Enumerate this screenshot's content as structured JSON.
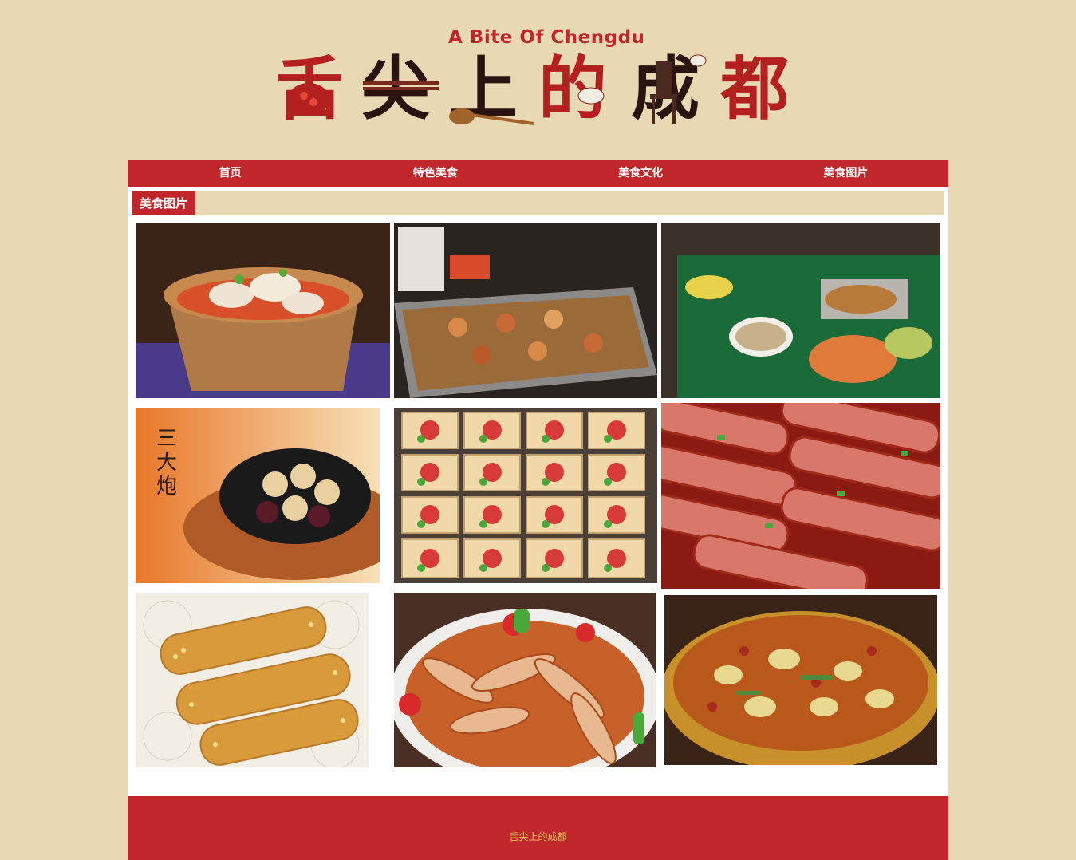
{
  "logo": {
    "title_en": "A Bite Of Chengdu",
    "title_cn_chars": [
      "舌",
      "尖",
      "上",
      "的",
      "成",
      "都"
    ]
  },
  "nav": {
    "items": [
      {
        "label": "首页"
      },
      {
        "label": "特色美食"
      },
      {
        "label": "美食文化"
      },
      {
        "label": "美食图片"
      }
    ]
  },
  "section": {
    "title": "美食图片"
  },
  "gallery": {
    "photos": [
      {
        "name": "dumplings-photo"
      },
      {
        "name": "street-skewers-photo"
      },
      {
        "name": "banquet-table-photo"
      },
      {
        "name": "sandapao-photo"
      },
      {
        "name": "tofu-photo"
      },
      {
        "name": "jelly-noodles-photo"
      },
      {
        "name": "sesame-rolls-photo"
      },
      {
        "name": "spicy-fish-photo"
      },
      {
        "name": "spicy-lotus-root-photo"
      }
    ]
  },
  "footer": {
    "text": "舌尖上的成都"
  },
  "colors": {
    "background": "#e8d9b4",
    "accent_red": "#c0262a",
    "footer_text": "#e8c060"
  }
}
